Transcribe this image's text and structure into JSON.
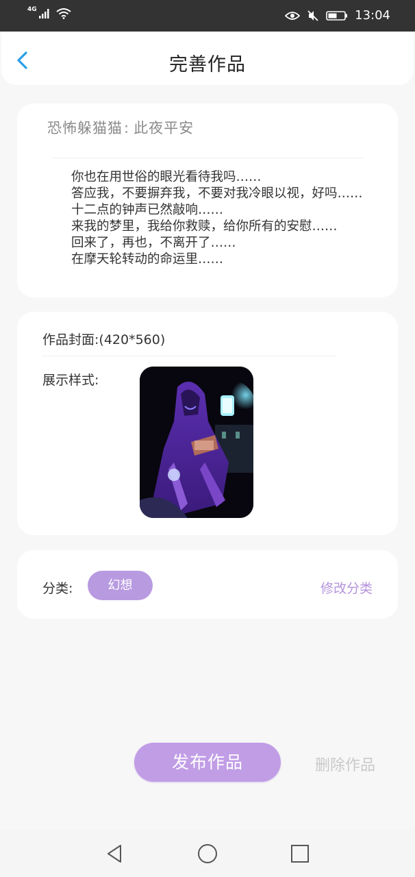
{
  "status_bar": {
    "network": "4G",
    "time": "13:04"
  },
  "header": {
    "title": "完善作品",
    "back_icon": "chevron-left-icon"
  },
  "work": {
    "category_prefix": "恐怖躲猫猫",
    "separator": ":",
    "name": "此夜平安",
    "excerpt": [
      "你也在用世俗的眼光看待我吗……",
      "答应我，不要摒弃我，不要对我冷眼以视，好吗……",
      "十二点的钟声已然敲响……",
      "来我的梦里，我给你救赎，给你所有的安慰……",
      "回来了，再也，不离开了……",
      "在摩天轮转动的命运里……"
    ]
  },
  "cover": {
    "label": "作品封面:",
    "size": "(420*560)",
    "display_label": "展示样式:"
  },
  "category": {
    "label": "分类:",
    "selected": "幻想",
    "modify_link": "修改分类"
  },
  "actions": {
    "publish": "发布作品",
    "delete": "删除作品"
  },
  "colors": {
    "accent": "#c19de6",
    "chip": "#b89ae1",
    "link": "#b493dd",
    "back_arrow": "#2a9ee6"
  },
  "nav": {
    "back": "nav-back-icon",
    "home": "nav-home-icon",
    "recents": "nav-recents-icon"
  }
}
